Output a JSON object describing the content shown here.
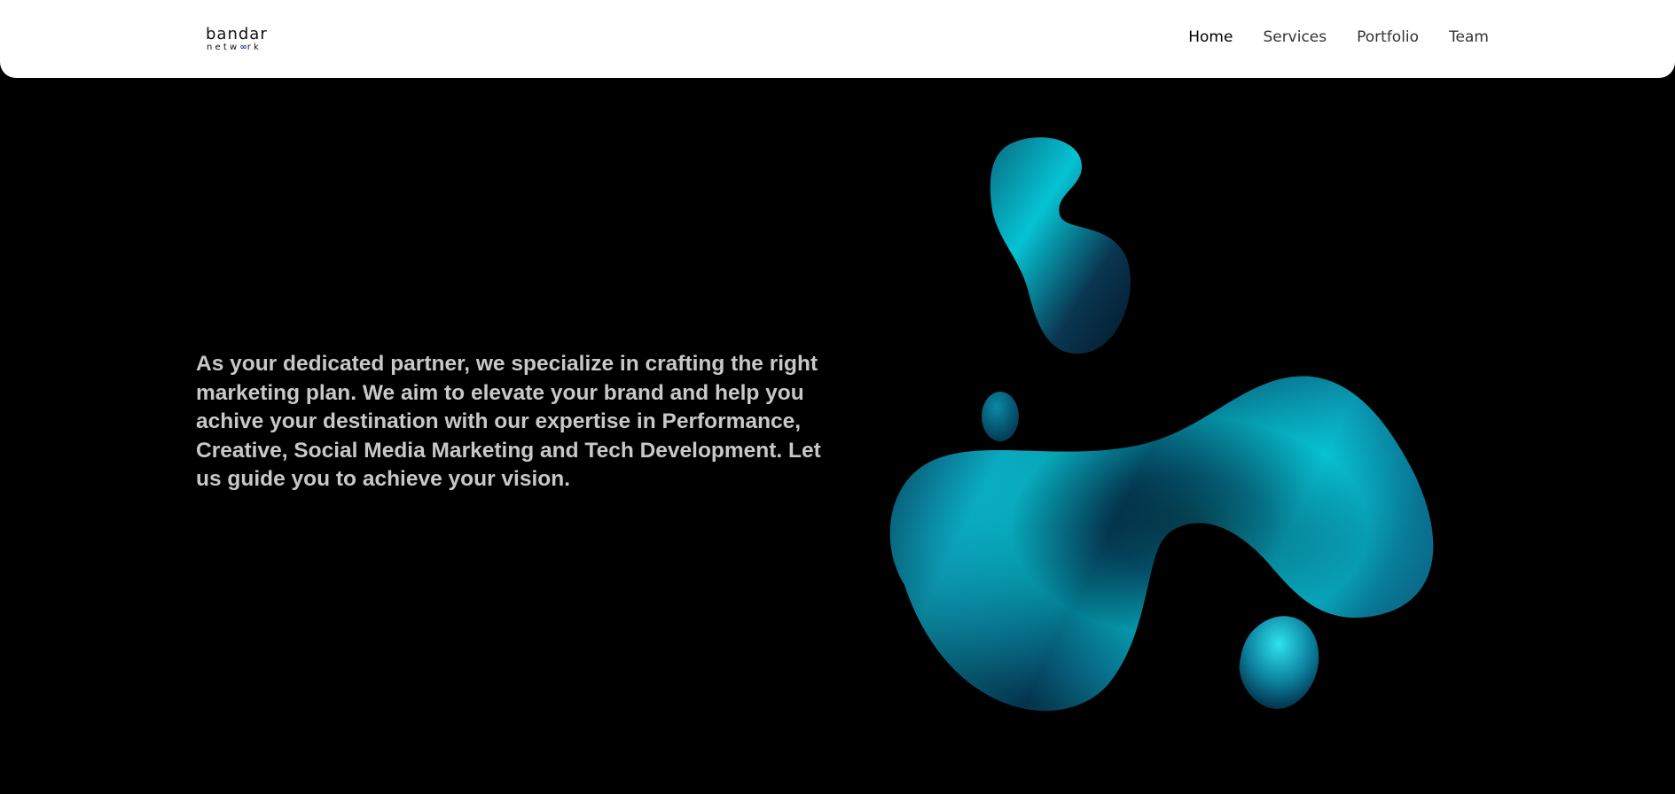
{
  "header": {
    "logo": {
      "line1": "bandar",
      "line2_left": "netw",
      "line2_loop": "∞",
      "line2_right": "rk"
    },
    "nav": [
      {
        "label": "Home",
        "active": true
      },
      {
        "label": "Services",
        "active": false
      },
      {
        "label": "Portfolio",
        "active": false
      },
      {
        "label": "Team",
        "active": false
      }
    ]
  },
  "hero": {
    "text": "As your dedicated partner, we specialize in crafting the right marketing plan. We aim to elevate your brand and help you achive your destination with our expertise in Performance, Creative, Social Media Marketing and Tech Development. Let us guide you to achieve your vision."
  },
  "colors": {
    "background": "#000000",
    "header": "#ffffff",
    "hero_text": "#c8c8c8",
    "blob_light": "#06d3e0",
    "blob_dark": "#04435e",
    "logo_accent": "#1f2bb8"
  }
}
